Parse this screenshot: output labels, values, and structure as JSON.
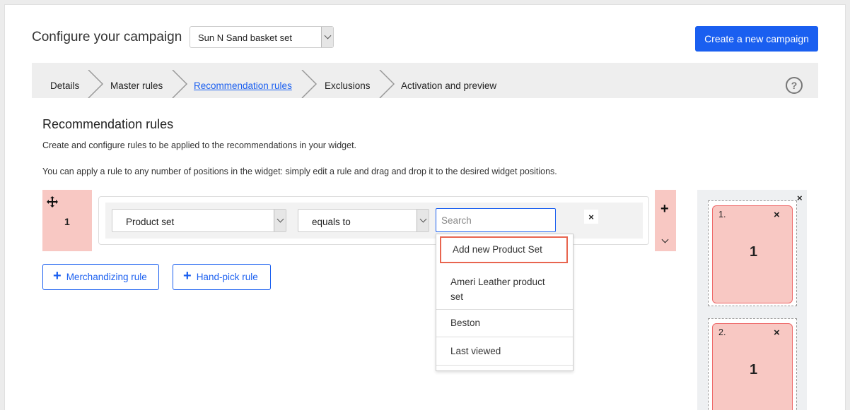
{
  "header": {
    "title": "Configure your campaign",
    "campaign_select_value": "Sun N Sand basket set",
    "create_button": "Create a new campaign"
  },
  "steps": [
    {
      "label": "Details",
      "active": false
    },
    {
      "label": "Master rules",
      "active": false
    },
    {
      "label": "Recommendation rules",
      "active": true
    },
    {
      "label": "Exclusions",
      "active": false
    },
    {
      "label": "Activation and preview",
      "active": false
    }
  ],
  "help_icon": "?",
  "section": {
    "title": "Recommendation rules",
    "desc1": "Create and configure rules to be applied to the recommendations in your widget.",
    "desc2": "You can apply a rule to any number of positions in the widget: simply edit a rule and drag and drop it to the desired widget positions."
  },
  "rule": {
    "number": "1",
    "field_select": "Product set",
    "operator_select": "equals to",
    "search_placeholder": "Search",
    "remove_glyph": "×",
    "add_glyph": "+"
  },
  "dropdown": {
    "items": [
      "Add new Product Set",
      "Ameri Leather product set",
      "Beston",
      "Last viewed"
    ]
  },
  "buttons": {
    "merchandizing": "Merchandizing rule",
    "handpick": "Hand-pick rule",
    "plus_glyph": "+"
  },
  "widget": {
    "close_glyph": "×",
    "slots": [
      {
        "label": "1.",
        "rule": "1",
        "close": "×"
      },
      {
        "label": "2.",
        "rule": "1",
        "close": "×"
      }
    ]
  },
  "colors": {
    "accent": "#1a5ff0",
    "rule_bg": "#f8c8c3",
    "highlight_border": "#e8654f"
  }
}
